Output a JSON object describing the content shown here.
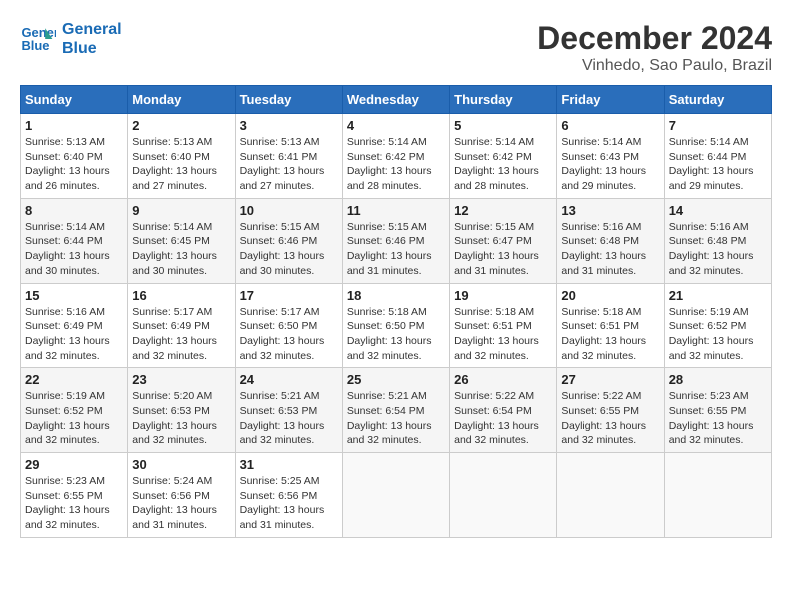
{
  "logo": {
    "line1": "General",
    "line2": "Blue"
  },
  "title": "December 2024",
  "subtitle": "Vinhedo, Sao Paulo, Brazil",
  "weekdays": [
    "Sunday",
    "Monday",
    "Tuesday",
    "Wednesday",
    "Thursday",
    "Friday",
    "Saturday"
  ],
  "weeks": [
    [
      {
        "day": "1",
        "info": "Sunrise: 5:13 AM\nSunset: 6:40 PM\nDaylight: 13 hours\nand 26 minutes."
      },
      {
        "day": "2",
        "info": "Sunrise: 5:13 AM\nSunset: 6:40 PM\nDaylight: 13 hours\nand 27 minutes."
      },
      {
        "day": "3",
        "info": "Sunrise: 5:13 AM\nSunset: 6:41 PM\nDaylight: 13 hours\nand 27 minutes."
      },
      {
        "day": "4",
        "info": "Sunrise: 5:14 AM\nSunset: 6:42 PM\nDaylight: 13 hours\nand 28 minutes."
      },
      {
        "day": "5",
        "info": "Sunrise: 5:14 AM\nSunset: 6:42 PM\nDaylight: 13 hours\nand 28 minutes."
      },
      {
        "day": "6",
        "info": "Sunrise: 5:14 AM\nSunset: 6:43 PM\nDaylight: 13 hours\nand 29 minutes."
      },
      {
        "day": "7",
        "info": "Sunrise: 5:14 AM\nSunset: 6:44 PM\nDaylight: 13 hours\nand 29 minutes."
      }
    ],
    [
      {
        "day": "8",
        "info": "Sunrise: 5:14 AM\nSunset: 6:44 PM\nDaylight: 13 hours\nand 30 minutes."
      },
      {
        "day": "9",
        "info": "Sunrise: 5:14 AM\nSunset: 6:45 PM\nDaylight: 13 hours\nand 30 minutes."
      },
      {
        "day": "10",
        "info": "Sunrise: 5:15 AM\nSunset: 6:46 PM\nDaylight: 13 hours\nand 30 minutes."
      },
      {
        "day": "11",
        "info": "Sunrise: 5:15 AM\nSunset: 6:46 PM\nDaylight: 13 hours\nand 31 minutes."
      },
      {
        "day": "12",
        "info": "Sunrise: 5:15 AM\nSunset: 6:47 PM\nDaylight: 13 hours\nand 31 minutes."
      },
      {
        "day": "13",
        "info": "Sunrise: 5:16 AM\nSunset: 6:48 PM\nDaylight: 13 hours\nand 31 minutes."
      },
      {
        "day": "14",
        "info": "Sunrise: 5:16 AM\nSunset: 6:48 PM\nDaylight: 13 hours\nand 32 minutes."
      }
    ],
    [
      {
        "day": "15",
        "info": "Sunrise: 5:16 AM\nSunset: 6:49 PM\nDaylight: 13 hours\nand 32 minutes."
      },
      {
        "day": "16",
        "info": "Sunrise: 5:17 AM\nSunset: 6:49 PM\nDaylight: 13 hours\nand 32 minutes."
      },
      {
        "day": "17",
        "info": "Sunrise: 5:17 AM\nSunset: 6:50 PM\nDaylight: 13 hours\nand 32 minutes."
      },
      {
        "day": "18",
        "info": "Sunrise: 5:18 AM\nSunset: 6:50 PM\nDaylight: 13 hours\nand 32 minutes."
      },
      {
        "day": "19",
        "info": "Sunrise: 5:18 AM\nSunset: 6:51 PM\nDaylight: 13 hours\nand 32 minutes."
      },
      {
        "day": "20",
        "info": "Sunrise: 5:18 AM\nSunset: 6:51 PM\nDaylight: 13 hours\nand 32 minutes."
      },
      {
        "day": "21",
        "info": "Sunrise: 5:19 AM\nSunset: 6:52 PM\nDaylight: 13 hours\nand 32 minutes."
      }
    ],
    [
      {
        "day": "22",
        "info": "Sunrise: 5:19 AM\nSunset: 6:52 PM\nDaylight: 13 hours\nand 32 minutes."
      },
      {
        "day": "23",
        "info": "Sunrise: 5:20 AM\nSunset: 6:53 PM\nDaylight: 13 hours\nand 32 minutes."
      },
      {
        "day": "24",
        "info": "Sunrise: 5:21 AM\nSunset: 6:53 PM\nDaylight: 13 hours\nand 32 minutes."
      },
      {
        "day": "25",
        "info": "Sunrise: 5:21 AM\nSunset: 6:54 PM\nDaylight: 13 hours\nand 32 minutes."
      },
      {
        "day": "26",
        "info": "Sunrise: 5:22 AM\nSunset: 6:54 PM\nDaylight: 13 hours\nand 32 minutes."
      },
      {
        "day": "27",
        "info": "Sunrise: 5:22 AM\nSunset: 6:55 PM\nDaylight: 13 hours\nand 32 minutes."
      },
      {
        "day": "28",
        "info": "Sunrise: 5:23 AM\nSunset: 6:55 PM\nDaylight: 13 hours\nand 32 minutes."
      }
    ],
    [
      {
        "day": "29",
        "info": "Sunrise: 5:23 AM\nSunset: 6:55 PM\nDaylight: 13 hours\nand 32 minutes."
      },
      {
        "day": "30",
        "info": "Sunrise: 5:24 AM\nSunset: 6:56 PM\nDaylight: 13 hours\nand 31 minutes."
      },
      {
        "day": "31",
        "info": "Sunrise: 5:25 AM\nSunset: 6:56 PM\nDaylight: 13 hours\nand 31 minutes."
      },
      null,
      null,
      null,
      null
    ]
  ]
}
